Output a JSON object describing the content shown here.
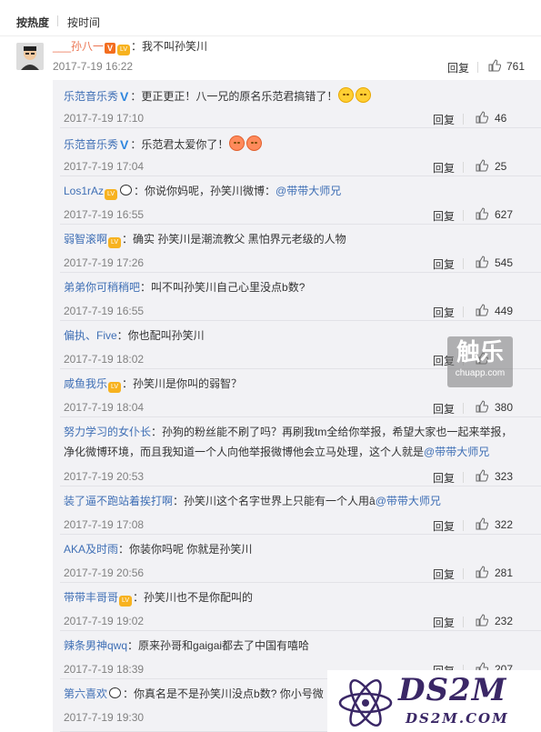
{
  "tabs": {
    "hot": "按热度",
    "time": "按时间"
  },
  "main_comment": {
    "user": "___孙八一",
    "text": "：我不叫孙笑川",
    "time": "2017-7-19 16:22",
    "reply": "回复",
    "likes": "761"
  },
  "replies": [
    {
      "user": "乐范音乐秀",
      "badge": "v-blue",
      "text": "：更正更正！八一兄的原名乐范君搞错了！",
      "emoji": 2,
      "time": "2017-7-19 17:10",
      "likes": "46"
    },
    {
      "user": "乐范音乐秀",
      "badge": "v-blue",
      "text": "：乐范君太爱你了！",
      "emoji": 2,
      "emoji_color": "red",
      "time": "2017-7-19 17:04",
      "likes": "25"
    },
    {
      "user": "Los1rAz",
      "badge": "lv-panda",
      "text": "：你说你妈呢，孙笑川微博：",
      "mention": "@带带大师兄",
      "time": "2017-7-19 16:55",
      "likes": "627"
    },
    {
      "user": "弱智滚啊",
      "badge": "lv",
      "text": "：确实 孙笑川是潮流教父 黑怕界元老级的人物",
      "time": "2017-7-19 17:26",
      "likes": "545"
    },
    {
      "user": "弟弟你可稍稍吧",
      "badge": "",
      "text": "：叫不叫孙笑川自己心里没点b数?",
      "time": "2017-7-19 16:55",
      "likes": "449"
    },
    {
      "user": "偏执、Five",
      "badge": "",
      "text": "：你也配叫孙笑川",
      "time": "2017-7-19 18:02",
      "likes": ""
    },
    {
      "user": "咸鱼我乐",
      "badge": "lv",
      "text": "：孙笑川是你叫的弱智？",
      "time": "2017-7-19 18:04",
      "likes": "380"
    },
    {
      "user": "努力学习的女仆长",
      "badge": "",
      "text": "：孙狗的粉丝能不刷了吗？再刷我tm全给你举报，希望大家也一起来举报，",
      "text2": "净化微博环境，而且我知道一个人向他举报微博他会立马处理，这个人就是",
      "mention": "@带带大师兄",
      "time": "2017-7-19 20:53",
      "likes": "323"
    },
    {
      "user": "装了逼不跑站着挨打啊",
      "badge": "",
      "text": "：孙笑川这个名字世界上只能有一个人用â",
      "mention": "@带带大师兄",
      "time": "2017-7-19 17:08",
      "likes": "322"
    },
    {
      "user": "AKA及时雨",
      "badge": "",
      "text": "：你装你吗呢 你就是孙笑川",
      "time": "2017-7-19 20:56",
      "likes": "281"
    },
    {
      "user": "带带丰哥哥",
      "badge": "lv",
      "text": "：孙笑川也不是你配叫的",
      "time": "2017-7-19 19:02",
      "likes": "232"
    },
    {
      "user": "辣条男神qwq",
      "badge": "",
      "text": "：原来孙哥和gaigai都去了中国有嘻哈",
      "time": "2017-7-19 18:39",
      "likes": "207"
    },
    {
      "user": "第六喜欢",
      "badge": "panda",
      "text": "：你真名是不是孙笑川没点b数? 你小号微",
      "time": "2017-7-19 19:30",
      "likes": ""
    }
  ],
  "reply_label": "回复",
  "watermarks": {
    "chuapp_big": "触乐",
    "chuapp_small": "chuapp.com",
    "ds2m": "DS2M",
    "ds2m_site": "DS2M.COM"
  }
}
